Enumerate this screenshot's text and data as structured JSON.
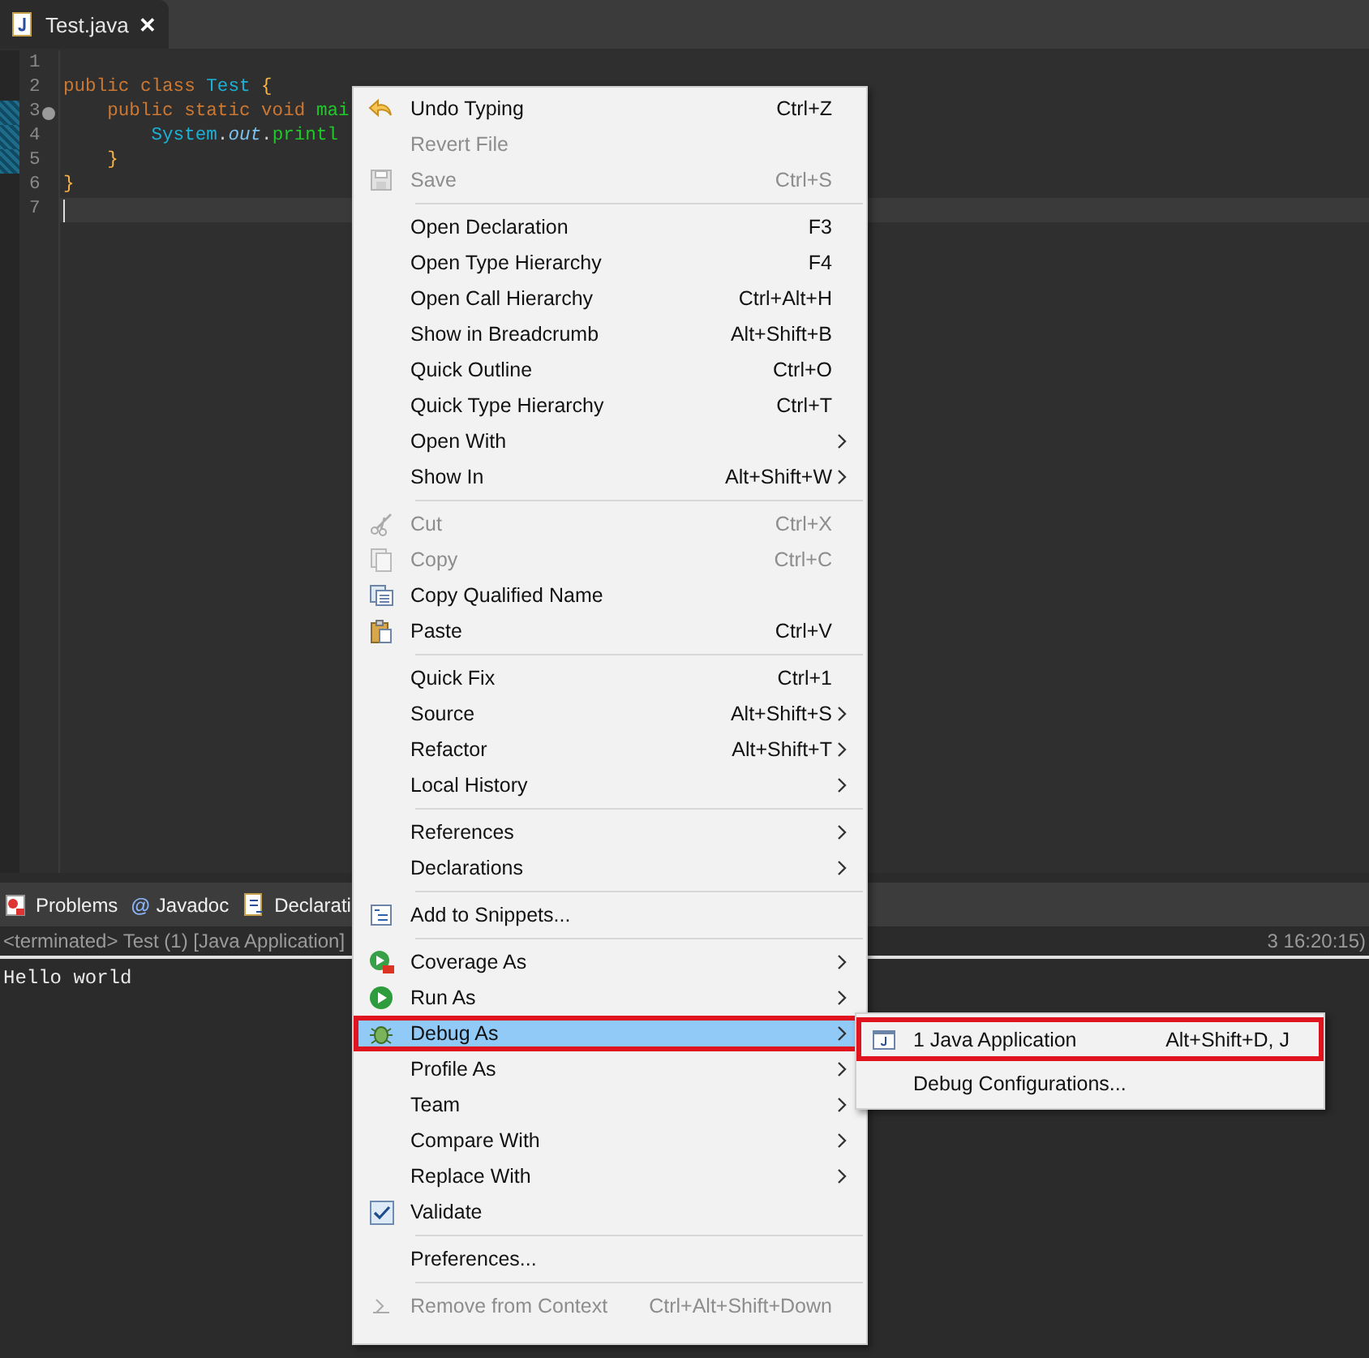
{
  "editor_tab": {
    "label": "Test.java",
    "close": "✕",
    "selected": true
  },
  "editor": {
    "lines": [
      {
        "number": "1",
        "fold": false,
        "changed": false,
        "current": false
      },
      {
        "number": "2",
        "fold": false,
        "changed": false,
        "current": false,
        "tokens": [
          {
            "text": "public class ",
            "kind": "keyword"
          },
          {
            "text": "Test",
            "kind": "type"
          },
          {
            "text": " {",
            "kind": "brace"
          }
        ]
      },
      {
        "number": "3",
        "fold": true,
        "changed": true,
        "current": false,
        "tokens": [
          {
            "text": "    public static void ",
            "kind": "keyword"
          },
          {
            "text": "mai",
            "kind": "method"
          }
        ]
      },
      {
        "number": "4",
        "fold": false,
        "changed": true,
        "current": false,
        "tokens": [
          {
            "text": "        System",
            "kind": "type"
          },
          {
            "text": ".",
            "kind": "plain"
          },
          {
            "text": "out",
            "kind": "field"
          },
          {
            "text": ".",
            "kind": "plain"
          },
          {
            "text": "printl",
            "kind": "method"
          }
        ]
      },
      {
        "number": "5",
        "fold": false,
        "changed": true,
        "current": false,
        "tokens": [
          {
            "text": "    }",
            "kind": "brace"
          }
        ]
      },
      {
        "number": "6",
        "fold": false,
        "changed": false,
        "current": false,
        "tokens": [
          {
            "text": "}",
            "kind": "brace"
          }
        ]
      },
      {
        "number": "7",
        "fold": false,
        "changed": false,
        "current": true
      }
    ]
  },
  "panel_tabs": [
    {
      "label": "Problems",
      "selected": false
    },
    {
      "label": "Javadoc",
      "glyph": "@",
      "selected": false
    },
    {
      "label": "Declarati",
      "selected": false
    }
  ],
  "console": {
    "status_left": "<terminated> Test (1) [Java Application]",
    "status_right": "3 16:20:15)",
    "output": "Hello world"
  },
  "context_menu": {
    "sections": [
      [
        {
          "label": "Undo Typing",
          "shortcut": "Ctrl+Z",
          "kind": "command",
          "disabled": false,
          "has_submenu": false,
          "selected": false,
          "highlighted": false
        },
        {
          "label": "Revert File",
          "kind": "command",
          "disabled": true,
          "has_submenu": false,
          "selected": false,
          "highlighted": false
        },
        {
          "label": "Save",
          "shortcut": "Ctrl+S",
          "kind": "command",
          "disabled": true,
          "has_submenu": false,
          "selected": false,
          "highlighted": false
        }
      ],
      [
        {
          "label": "Open Declaration",
          "shortcut": "F3",
          "kind": "command",
          "disabled": false,
          "has_submenu": false,
          "selected": false,
          "highlighted": false
        },
        {
          "label": "Open Type Hierarchy",
          "shortcut": "F4",
          "kind": "command",
          "disabled": false,
          "has_submenu": false,
          "selected": false,
          "highlighted": false
        },
        {
          "label": "Open Call Hierarchy",
          "shortcut": "Ctrl+Alt+H",
          "kind": "command",
          "disabled": false,
          "has_submenu": false,
          "selected": false,
          "highlighted": false
        },
        {
          "label": "Show in Breadcrumb",
          "shortcut": "Alt+Shift+B",
          "kind": "command",
          "disabled": false,
          "has_submenu": false,
          "selected": false,
          "highlighted": false
        },
        {
          "label": "Quick Outline",
          "shortcut": "Ctrl+O",
          "kind": "command",
          "disabled": false,
          "has_submenu": false,
          "selected": false,
          "highlighted": false
        },
        {
          "label": "Quick Type Hierarchy",
          "shortcut": "Ctrl+T",
          "kind": "command",
          "disabled": false,
          "has_submenu": false,
          "selected": false,
          "highlighted": false
        },
        {
          "label": "Open With",
          "kind": "command",
          "disabled": false,
          "has_submenu": true,
          "selected": false,
          "highlighted": false
        },
        {
          "label": "Show In",
          "shortcut": "Alt+Shift+W",
          "kind": "command",
          "disabled": false,
          "has_submenu": true,
          "selected": false,
          "highlighted": false
        }
      ],
      [
        {
          "label": "Cut",
          "shortcut": "Ctrl+X",
          "kind": "command",
          "disabled": true,
          "has_submenu": false,
          "selected": false,
          "highlighted": false
        },
        {
          "label": "Copy",
          "shortcut": "Ctrl+C",
          "kind": "command",
          "disabled": true,
          "has_submenu": false,
          "selected": false,
          "highlighted": false
        },
        {
          "label": "Copy Qualified Name",
          "kind": "command",
          "disabled": false,
          "has_submenu": false,
          "selected": false,
          "highlighted": false
        },
        {
          "label": "Paste",
          "shortcut": "Ctrl+V",
          "kind": "command",
          "disabled": false,
          "has_submenu": false,
          "selected": false,
          "highlighted": false
        }
      ],
      [
        {
          "label": "Quick Fix",
          "shortcut": "Ctrl+1",
          "kind": "command",
          "disabled": false,
          "has_submenu": false,
          "selected": false,
          "highlighted": false
        },
        {
          "label": "Source",
          "shortcut": "Alt+Shift+S",
          "kind": "command",
          "disabled": false,
          "has_submenu": true,
          "selected": false,
          "highlighted": false
        },
        {
          "label": "Refactor",
          "shortcut": "Alt+Shift+T",
          "kind": "command",
          "disabled": false,
          "has_submenu": true,
          "selected": false,
          "highlighted": false
        },
        {
          "label": "Local History",
          "kind": "command",
          "disabled": false,
          "has_submenu": true,
          "selected": false,
          "highlighted": false
        }
      ],
      [
        {
          "label": "References",
          "kind": "command",
          "disabled": false,
          "has_submenu": true,
          "selected": false,
          "highlighted": false
        },
        {
          "label": "Declarations",
          "kind": "command",
          "disabled": false,
          "has_submenu": true,
          "selected": false,
          "highlighted": false
        }
      ],
      [
        {
          "label": "Add to Snippets...",
          "kind": "command",
          "disabled": false,
          "has_submenu": false,
          "selected": false,
          "highlighted": false
        }
      ],
      [
        {
          "label": "Coverage As",
          "kind": "command",
          "disabled": false,
          "has_submenu": true,
          "selected": false,
          "highlighted": false
        },
        {
          "label": "Run As",
          "kind": "command",
          "disabled": false,
          "has_submenu": true,
          "selected": false,
          "highlighted": false
        },
        {
          "label": "Debug As",
          "kind": "command",
          "disabled": false,
          "has_submenu": true,
          "selected": true,
          "highlighted": true
        },
        {
          "label": "Profile As",
          "kind": "command",
          "disabled": false,
          "has_submenu": true,
          "selected": false,
          "highlighted": false
        },
        {
          "label": "Team",
          "kind": "command",
          "disabled": false,
          "has_submenu": true,
          "selected": false,
          "highlighted": false
        },
        {
          "label": "Compare With",
          "kind": "command",
          "disabled": false,
          "has_submenu": true,
          "selected": false,
          "highlighted": false
        },
        {
          "label": "Replace With",
          "kind": "command",
          "disabled": false,
          "has_submenu": true,
          "selected": false,
          "highlighted": false
        },
        {
          "label": "Validate",
          "kind": "check",
          "checked": true,
          "disabled": false,
          "has_submenu": false,
          "selected": false,
          "highlighted": false
        }
      ],
      [
        {
          "label": "Preferences...",
          "kind": "command",
          "disabled": false,
          "has_submenu": false,
          "selected": false,
          "highlighted": false
        }
      ],
      [
        {
          "label": "Remove from Context",
          "shortcut": "Ctrl+Alt+Shift+Down",
          "kind": "command",
          "disabled": true,
          "has_submenu": false,
          "selected": false,
          "highlighted": false
        }
      ]
    ]
  },
  "submenu": {
    "items": [
      {
        "label": "1 Java Application",
        "shortcut": "Alt+Shift+D, J",
        "highlighted": true
      },
      {
        "label": "Debug Configurations...",
        "highlighted": false
      }
    ]
  }
}
